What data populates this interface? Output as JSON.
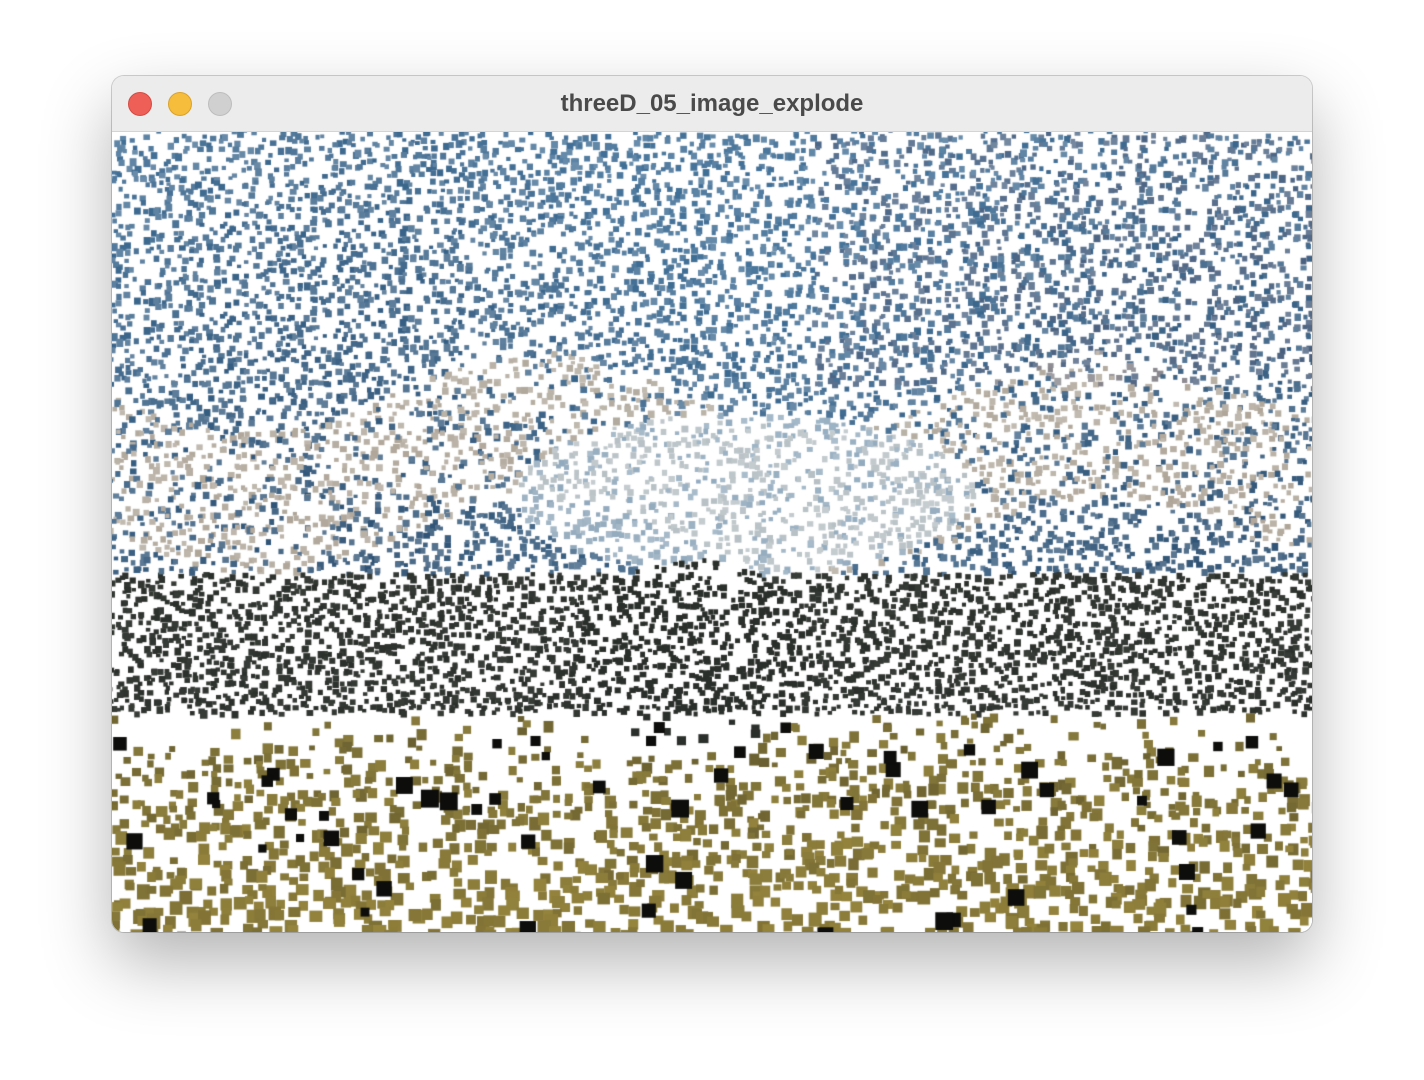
{
  "window": {
    "title": "threeD_05_image_explode",
    "buttons": {
      "close": "close-button",
      "minimize": "minimize-button",
      "zoom": "zoom-button"
    }
  },
  "sketch": {
    "content": "exploded image particles",
    "background": "#ffffff",
    "palette": {
      "sky_blue": "#3f6e96",
      "sky_dark": "#2a4a6a",
      "cloud_peach": "#e6c8a6",
      "haze_light": "#b9cad6",
      "trees_dark": "#2b2f2b",
      "field_olive": "#8a7d3e",
      "field_dark": "#4a4426"
    }
  }
}
